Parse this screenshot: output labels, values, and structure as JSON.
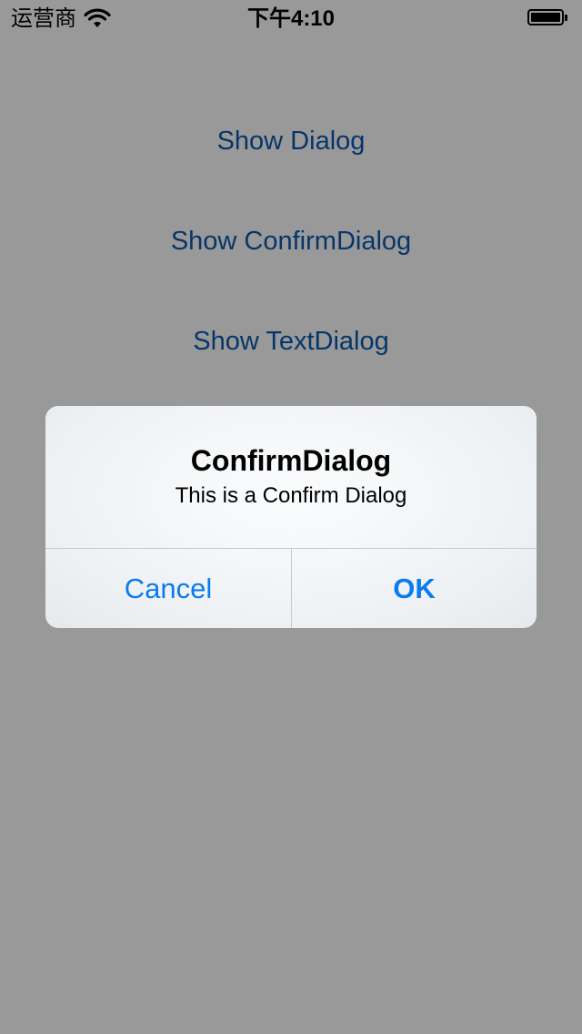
{
  "status_bar": {
    "carrier": "运营商",
    "time": "下午4:10",
    "wifi_icon": "wifi-icon",
    "battery_icon": "battery-icon",
    "battery_level": 1.0
  },
  "menu": {
    "items": [
      {
        "label": "Show Dialog"
      },
      {
        "label": "Show ConfirmDialog"
      },
      {
        "label": "Show TextDialog"
      }
    ]
  },
  "dialog": {
    "title": "ConfirmDialog",
    "message": "This is a Confirm Dialog",
    "cancel_label": "Cancel",
    "ok_label": "OK"
  },
  "colors": {
    "link_blue": "#0a5bb0",
    "alert_button_blue": "#0a7bf0",
    "overlay": "rgba(0,0,0,0.40)"
  }
}
